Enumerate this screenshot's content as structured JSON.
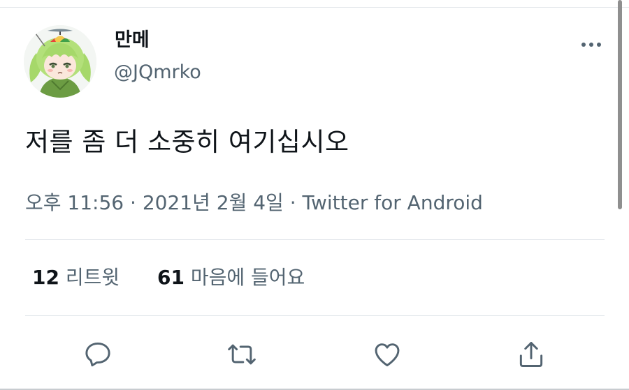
{
  "user": {
    "display_name": "만메",
    "handle": "@JQmrko",
    "avatar_icon": "anime-girl-propeller-hat-avatar"
  },
  "tweet": {
    "text": "저를 좀 더 소중히 여기십시오",
    "time": "오후 11:56",
    "date": "2021년 2월 4일",
    "separator": "·",
    "source": "Twitter for Android"
  },
  "stats": {
    "retweets_count": "12",
    "retweets_label": "리트윗",
    "likes_count": "61",
    "likes_label": "마음에 들어요"
  },
  "actions": {
    "reply_icon": "speech-bubble-icon",
    "retweet_icon": "retweet-arrows-icon",
    "like_icon": "heart-icon",
    "share_icon": "share-upload-icon"
  },
  "colors": {
    "text": "#0f1419",
    "secondary": "#536471",
    "divider": "#e1e6ea"
  }
}
